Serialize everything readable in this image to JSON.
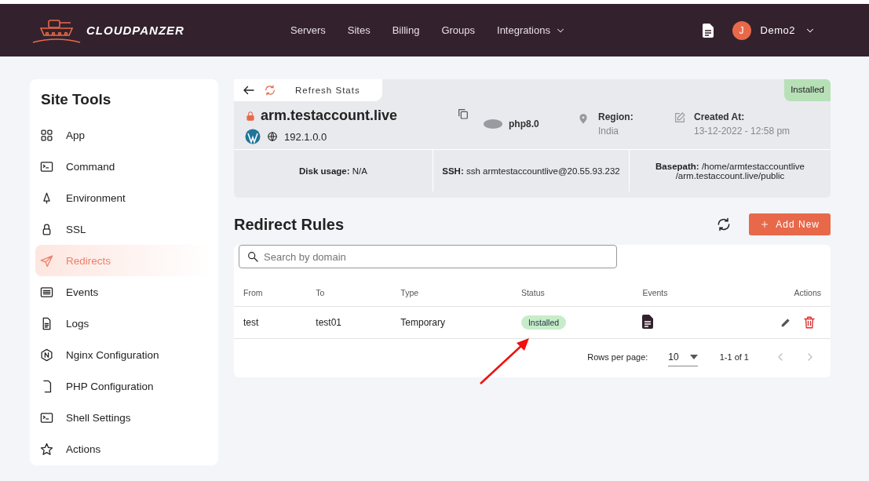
{
  "header": {
    "logo": "CLOUDPANZER",
    "nav": [
      {
        "label": "Servers",
        "dropdown": false
      },
      {
        "label": "Sites",
        "dropdown": false
      },
      {
        "label": "Billing",
        "dropdown": false
      },
      {
        "label": "Groups",
        "dropdown": false
      },
      {
        "label": "Integrations",
        "dropdown": true
      }
    ],
    "user_initial": "J",
    "user_name": "Demo2"
  },
  "sidebar": {
    "title": "Site Tools",
    "items": [
      {
        "label": "App",
        "kind": "grid",
        "selected": false
      },
      {
        "label": "Command",
        "kind": "terminal",
        "selected": false
      },
      {
        "label": "Environment",
        "kind": "tree",
        "selected": false
      },
      {
        "label": "SSL",
        "kind": "lock",
        "selected": false
      },
      {
        "label": "Redirects",
        "kind": "send",
        "selected": true
      },
      {
        "label": "Events",
        "kind": "list",
        "selected": false
      },
      {
        "label": "Logs",
        "kind": "doc",
        "selected": false
      },
      {
        "label": "Nginx Configuration",
        "kind": "nginx",
        "selected": false
      },
      {
        "label": "PHP Configuration",
        "kind": "php",
        "selected": false
      },
      {
        "label": "Shell Settings",
        "kind": "terminal",
        "selected": false
      },
      {
        "label": "Actions",
        "kind": "star",
        "selected": false
      }
    ]
  },
  "site": {
    "refresh_label": "Refresh Stats",
    "status": "Installed",
    "domain": "arm.testaccount.live",
    "ip": "192.1.0.0",
    "php": "php8.0",
    "region_label": "Region:",
    "region": "India",
    "created_label": "Created At:",
    "created": "13-12-2022 - 12:58 pm",
    "disk_label": "Disk usage:",
    "disk": "N/A",
    "ssh_label": "SSH:",
    "ssh": "ssh armtestaccountlive@20.55.93.232",
    "basepath_label": "Basepath:",
    "basepath": "/home/armtestaccountlive",
    "basepath_line2": "/arm.testaccount.live/public"
  },
  "redirects": {
    "title": "Redirect Rules",
    "add_button": "Add New",
    "search": {
      "placeholder": "Search by domain"
    },
    "columns": [
      "From",
      "To",
      "Type",
      "Status",
      "Events",
      "Actions"
    ],
    "rows": [
      {
        "from": "test",
        "to": "test01",
        "type": "Temporary",
        "status": "Installed"
      }
    ],
    "rows_per_page_label": "Rows per page:",
    "rows_per_page": "10",
    "range": "1-1 of 1"
  }
}
